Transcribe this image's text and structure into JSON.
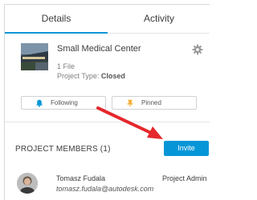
{
  "tabs": [
    {
      "label": "Details",
      "active": true
    },
    {
      "label": "Activity",
      "active": false
    }
  ],
  "project": {
    "title": "Small Medical Center",
    "files": "1 File",
    "type_prefix": "Project Type: ",
    "type_value": "Closed"
  },
  "actions": {
    "following_label": "Following",
    "pinned_label": "Pinned"
  },
  "members": {
    "header": "PROJECT MEMBERS (1)",
    "invite_label": "Invite",
    "list": [
      {
        "name": "Tomasz Fudala",
        "email": "tomasz.fudala@autodesk.com",
        "role": "Project Admin"
      }
    ]
  },
  "colors": {
    "accent": "#0696d7",
    "annotation_arrow": "#e5282c",
    "pinned_icon": "#f5a623"
  },
  "icons": [
    "settings-gear-icon",
    "bell-icon",
    "pin-icon",
    "arrow-annotation"
  ]
}
